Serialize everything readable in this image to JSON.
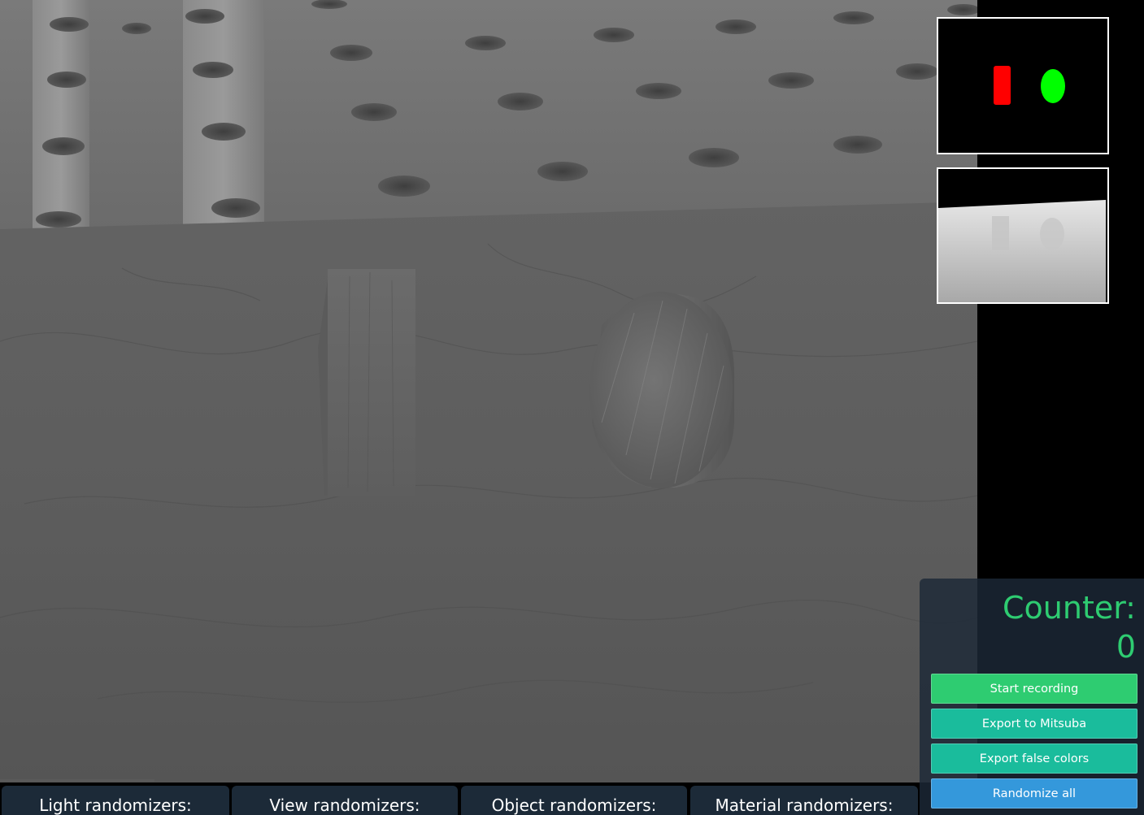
{
  "viewport": {
    "scene_objects": [
      "box-block",
      "cylinder"
    ]
  },
  "thumbnails": {
    "segmentation": {
      "red_object_color": "#ff0000",
      "green_object_color": "#00ff00"
    },
    "depth": {}
  },
  "panel": {
    "counter_label": "Counter:",
    "counter_value": "0",
    "buttons": {
      "start_recording": "Start recording",
      "export_mitsuba": "Export to Mitsuba",
      "export_false_colors": "Export false colors",
      "randomize_all": "Randomize all"
    }
  },
  "randomizer_tabs": {
    "light": "Light randomizers:",
    "view": "View randomizers:",
    "object": "Object randomizers:",
    "material": "Material randomizers:"
  },
  "colors": {
    "counter_text": "#2ecc71",
    "record_button": "#2ecc71",
    "export_button": "#1abc9c",
    "randomize_button": "#3498db",
    "panel_bg": "#1c2837"
  }
}
